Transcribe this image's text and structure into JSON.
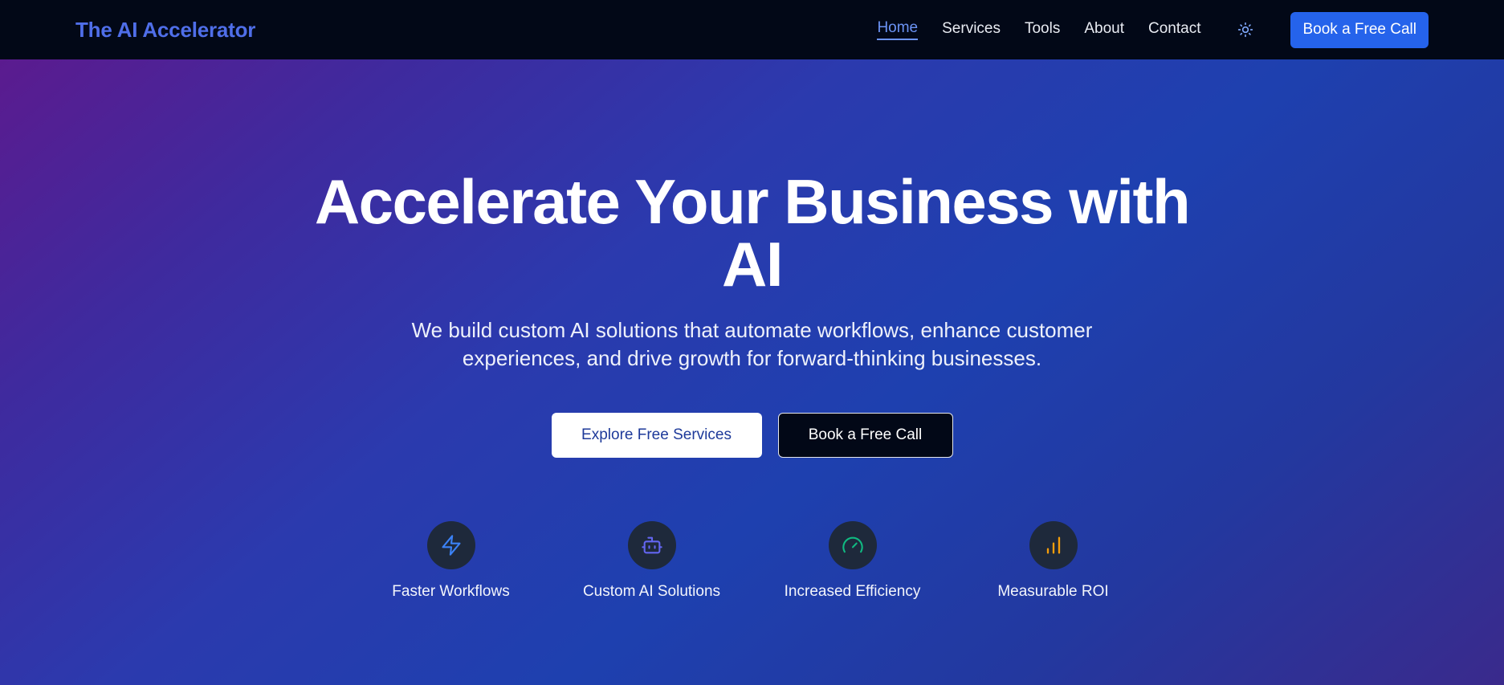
{
  "nav": {
    "brand": "The AI Accelerator",
    "links": [
      {
        "label": "Home",
        "active": true
      },
      {
        "label": "Services",
        "active": false
      },
      {
        "label": "Tools",
        "active": false
      },
      {
        "label": "About",
        "active": false
      },
      {
        "label": "Contact",
        "active": false
      }
    ],
    "theme_toggle_icon": "sun-icon",
    "cta_label": "Book a Free Call"
  },
  "hero": {
    "title_line1": "Accelerate Your Business with",
    "title_line2": "AI",
    "subtitle_line1": "We build custom AI solutions that automate workflows, enhance customer",
    "subtitle_line2": "experiences, and drive growth for forward-thinking businesses.",
    "primary_button": "Explore Free Services",
    "secondary_button": "Book a Free Call"
  },
  "features": [
    {
      "label": "Faster Workflows",
      "icon": "lightning-icon",
      "color": "#3b82f6"
    },
    {
      "label": "Custom AI Solutions",
      "icon": "bot-icon",
      "color": "#6366f1"
    },
    {
      "label": "Increased Efficiency",
      "icon": "gauge-icon",
      "color": "#10b981"
    },
    {
      "label": "Measurable ROI",
      "icon": "bar-chart-icon",
      "color": "#f59e0b"
    }
  ],
  "colors": {
    "brand": "#4f6ee8",
    "accent": "#2563eb",
    "nav_background": "#020817",
    "active_link": "#6b93f4"
  }
}
